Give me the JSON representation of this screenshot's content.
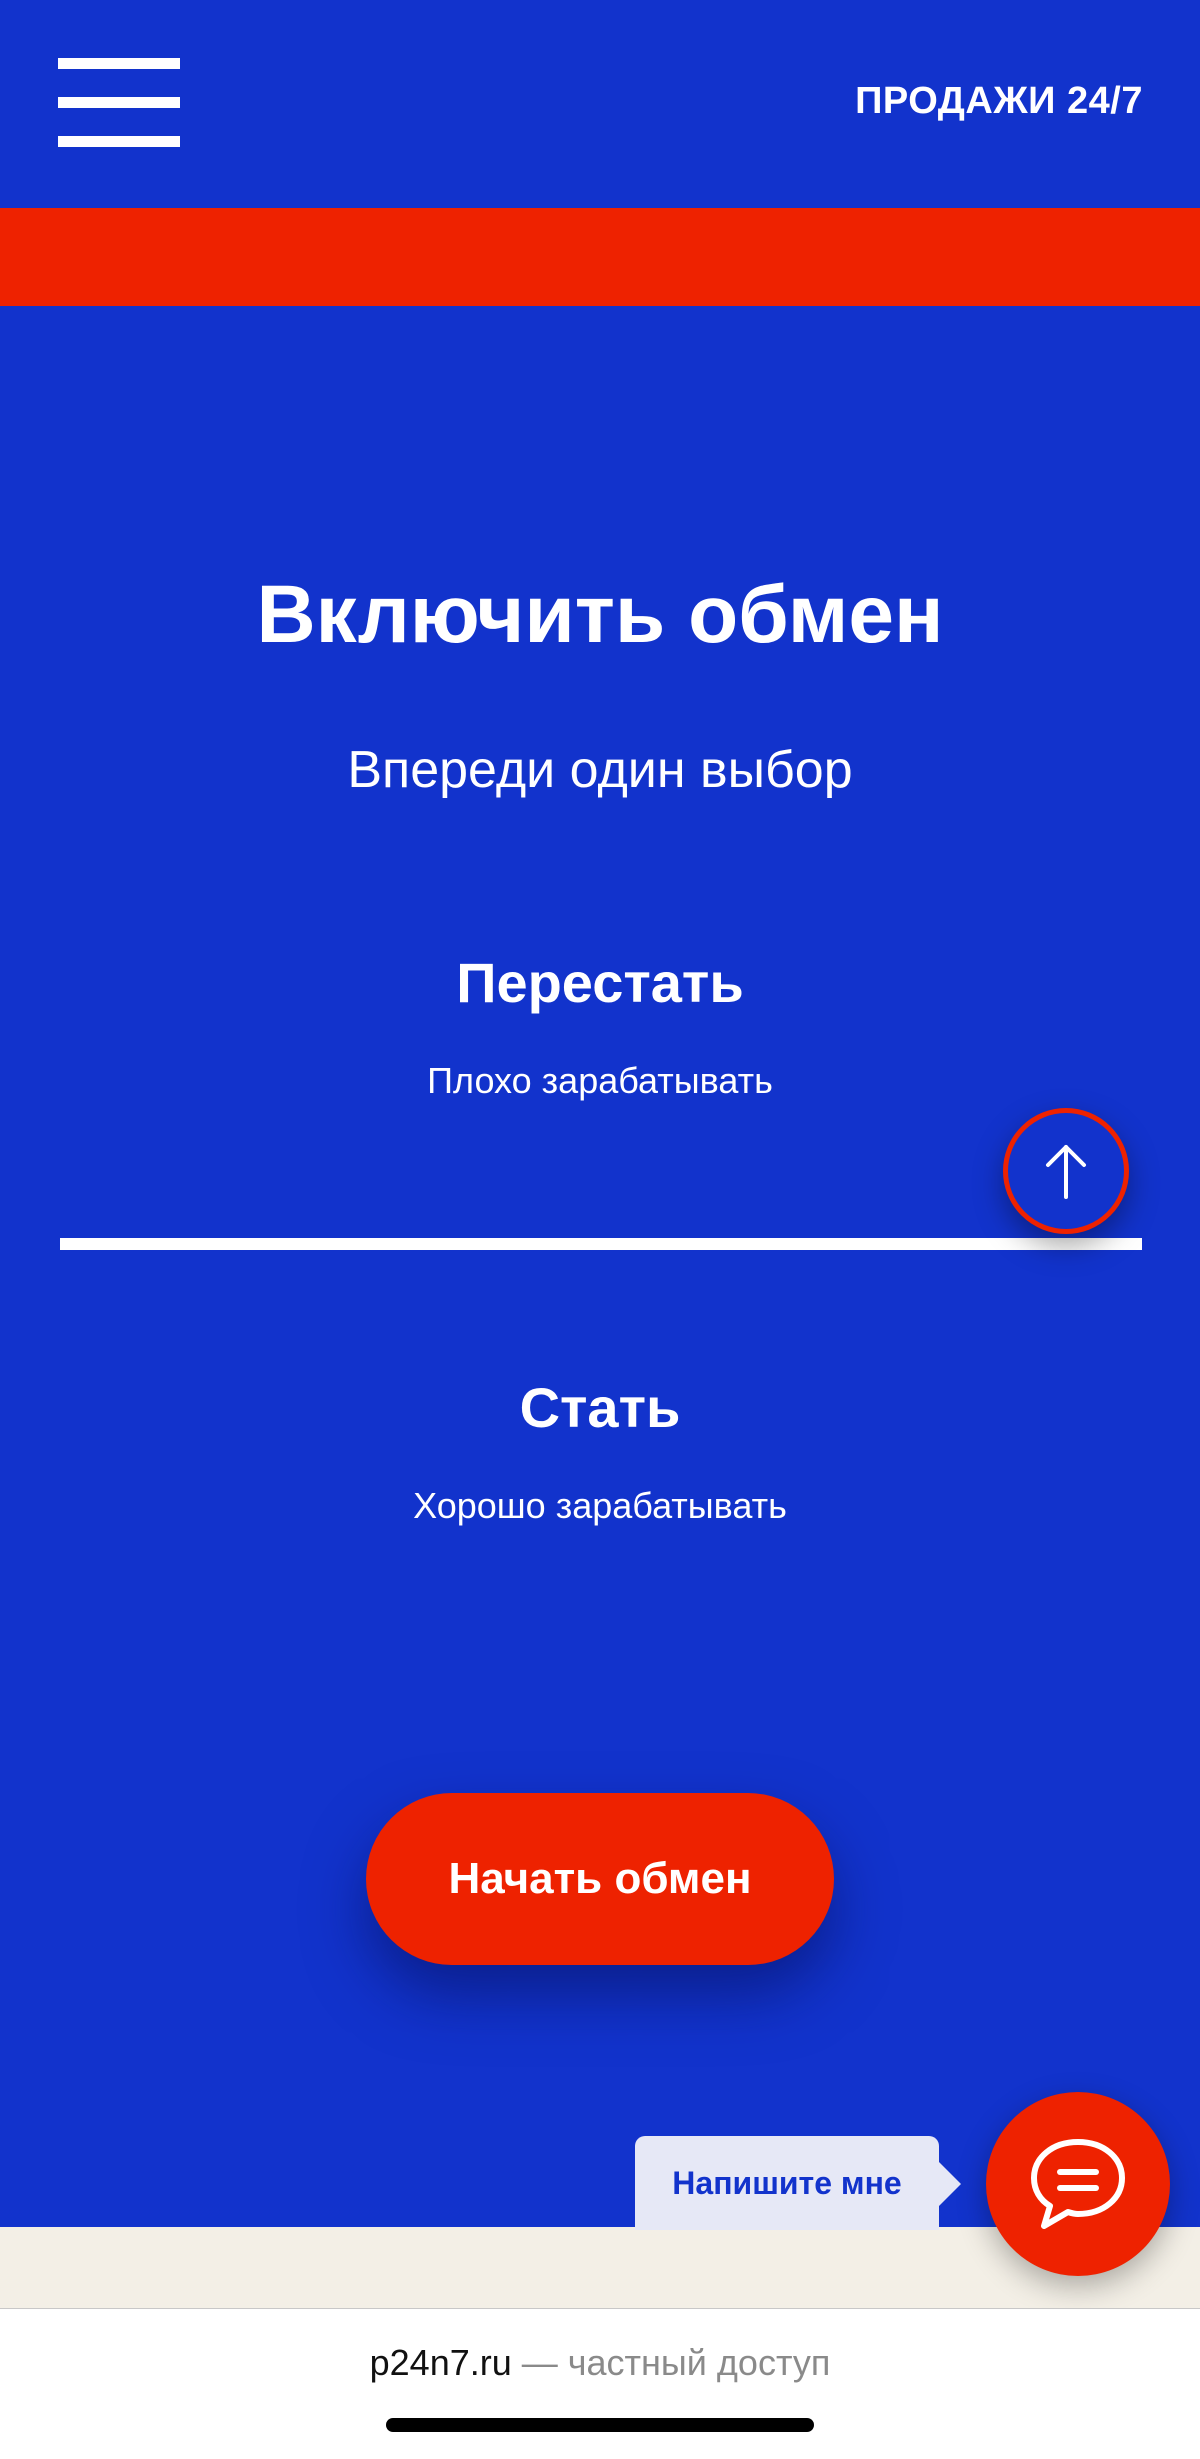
{
  "header": {
    "menu_icon": "hamburger-icon",
    "sales_label": "ПРОДАЖИ 24/7"
  },
  "hero": {
    "title": "Включить обмен",
    "subtitle": "Впереди один выбор"
  },
  "choices": [
    {
      "title": "Перестать",
      "subtitle": "Плохо зарабатывать"
    },
    {
      "title": "Стать",
      "subtitle": "Хорошо зарабатывать"
    }
  ],
  "scroll_top_icon": "arrow-up-icon",
  "cta": {
    "label": "Начать обмен"
  },
  "chat": {
    "tooltip": "Напишите мне",
    "icon": "chat-bubble-icon"
  },
  "browser": {
    "domain": "p24n7.ru",
    "description": "— частный доступ"
  },
  "colors": {
    "primary_blue": "#1233cc",
    "accent_red": "#ee2200",
    "white": "#ffffff",
    "beige": "#f3efe6"
  }
}
